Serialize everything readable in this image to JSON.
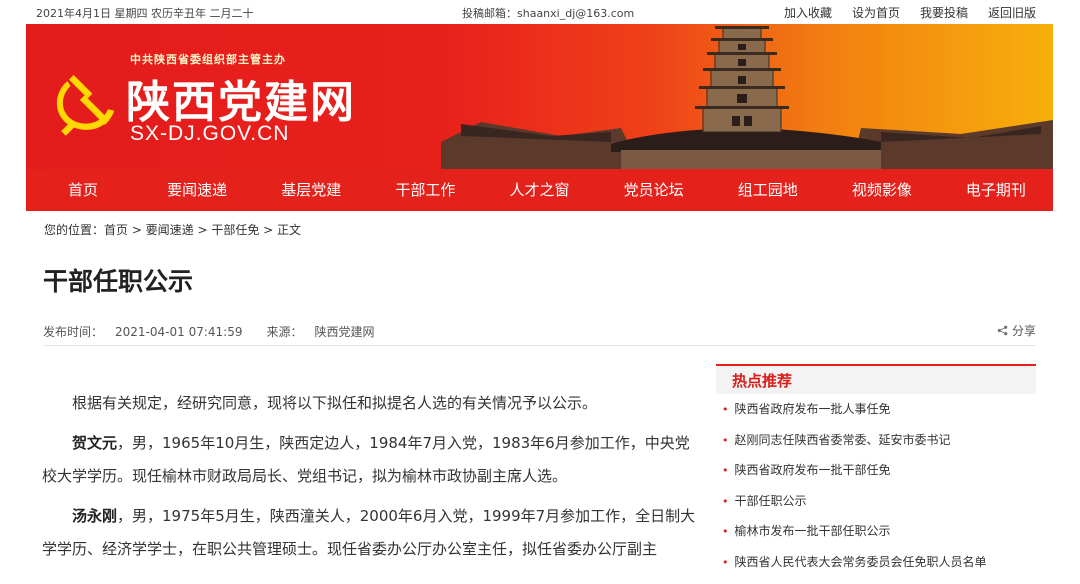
{
  "topbar": {
    "date": "2021年4月1日 星期四 农历辛丑年 二月二十",
    "email_label": "投稿邮箱：",
    "email": "shaanxi_dj@163.com",
    "links": [
      "加入收藏",
      "设为首页",
      "我要投稿",
      "返回旧版"
    ]
  },
  "banner": {
    "subtitle": "中共陕西省委组织部主管主办",
    "site_name": "陕西党建网",
    "domain": "SX-DJ.GOV.CN"
  },
  "nav": [
    "首页",
    "要闻速递",
    "基层党建",
    "干部工作",
    "人才之窗",
    "党员论坛",
    "组工园地",
    "视频影像",
    "电子期刊"
  ],
  "breadcrumb": "您的位置：首页 > 要闻速递 > 干部任免 > 正文",
  "article": {
    "title": "干部任职公示",
    "publish_label": "发布时间：",
    "publish_time": "2021-04-01 07:41:59",
    "source_label": "来源：",
    "source": "陕西党建网",
    "share": "分享",
    "intro": "根据有关规定，经研究同意，现将以下拟任和拟提名人选的有关情况予以公示。",
    "p1_name": "贺文元",
    "p1_text": "，男，1965年10月生，陕西定边人，1984年7月入党，1983年6月参加工作，中央党校大学学历。现任榆林市财政局局长、党组书记，拟为榆林市政协副主席人选。",
    "p2_name": "汤永刚",
    "p2_text": "，男，1975年5月生，陕西潼关人，2000年6月入党，1999年7月参加工作，全日制大学学历、经济学学士，在职公共管理硕士。现任省委办公厅办公室主任，拟任省委办公厅副主"
  },
  "sidebar": {
    "title": "热点推荐",
    "items": [
      "陕西省政府发布一批人事任免",
      "赵刚同志任陕西省委常委、延安市委书记",
      "陕西省政府发布一批干部任免",
      "干部任职公示",
      "榆林市发布一批干部任职公示",
      "陕西省人民代表大会常务委员会任免职人员名单"
    ]
  },
  "colors": {
    "brand_red": "#e5211b",
    "banner_orange": "#f6a90c"
  }
}
